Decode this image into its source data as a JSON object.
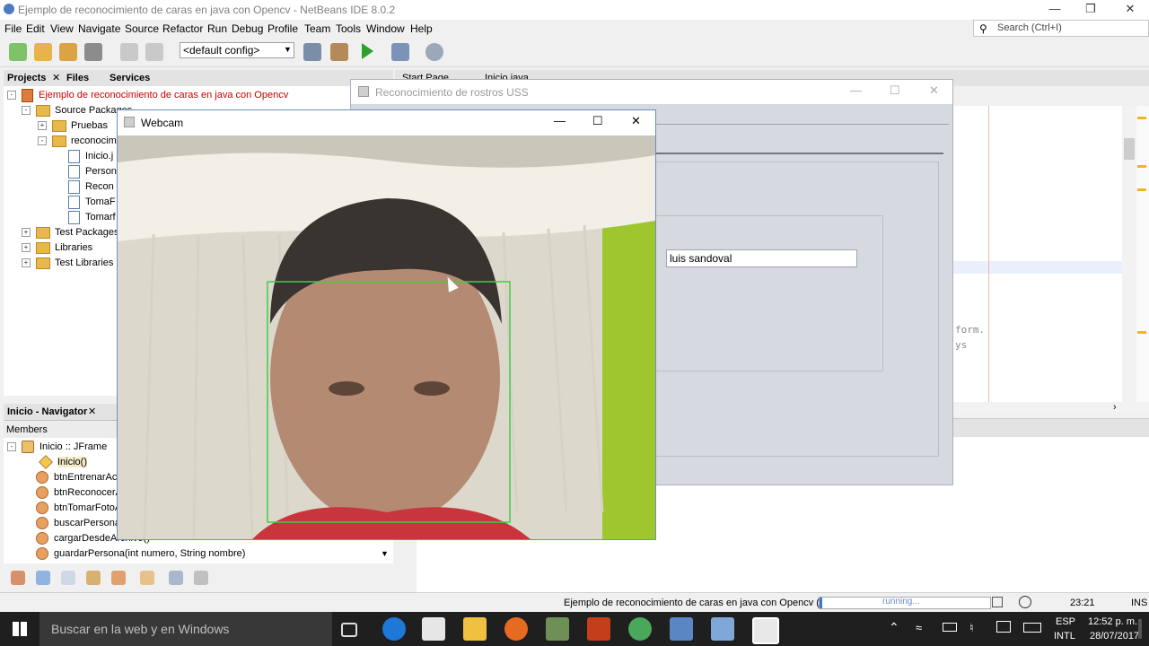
{
  "ide": {
    "title": "Ejemplo de reconocimiento de caras en java con Opencv - NetBeans IDE 8.0.2",
    "menu": [
      "File",
      "Edit",
      "View",
      "Navigate",
      "Source",
      "Refactor",
      "Run",
      "Debug",
      "Profile",
      "Team",
      "Tools",
      "Window",
      "Help"
    ],
    "config": "<default config>",
    "search_placeholder": "Search (Ctrl+I)",
    "editor_tabs": [
      "Start Page",
      "Inicio.java"
    ],
    "code_fragments": [
      "form.",
      "ys"
    ]
  },
  "projects": {
    "tabs": [
      "Projects",
      "Files",
      "Services"
    ],
    "root": "Ejemplo de reconocimiento de caras en java con Opencv",
    "source_packages": "Source Packages",
    "pkg1": "Pruebas",
    "pkg2": "reconocimi",
    "files": [
      "Inicio.j",
      "Person",
      "Recon",
      "TomaF",
      "Tomarf"
    ],
    "test_packages": "Test Packages",
    "libraries": "Libraries",
    "test_libraries": "Test Libraries"
  },
  "navigator": {
    "title": "Inicio - Navigator",
    "members_label": "Members",
    "root": "Inicio :: JFrame",
    "items": [
      "Inicio()",
      "btnEntrenarAc",
      "btnReconocerA",
      "btnTomarFotoA",
      "buscarPersona",
      "cargarDesdeArchivo()",
      "guardarPersona(int numero, String nombre)"
    ]
  },
  "recognizer": {
    "title": "Reconocimiento de rostros USS",
    "name_value": "luis sandoval"
  },
  "webcam": {
    "title": "Webcam"
  },
  "status": {
    "run_text": "Ejemplo de reconocimiento de caras en java con Opencv (run)",
    "progress": "running...",
    "position": "23:21",
    "mode": "INS"
  },
  "taskbar": {
    "search_placeholder": "Buscar en la web y en Windows",
    "lang1": "ESP",
    "lang2": "INTL",
    "time": "12:52 p. m.",
    "date": "28/07/2017"
  },
  "colors": {
    "ide_error_red": "#cc0000",
    "face_box": "#44cc44",
    "taskbar": "#1f1f1f",
    "wall_green": "#9ec62f"
  }
}
